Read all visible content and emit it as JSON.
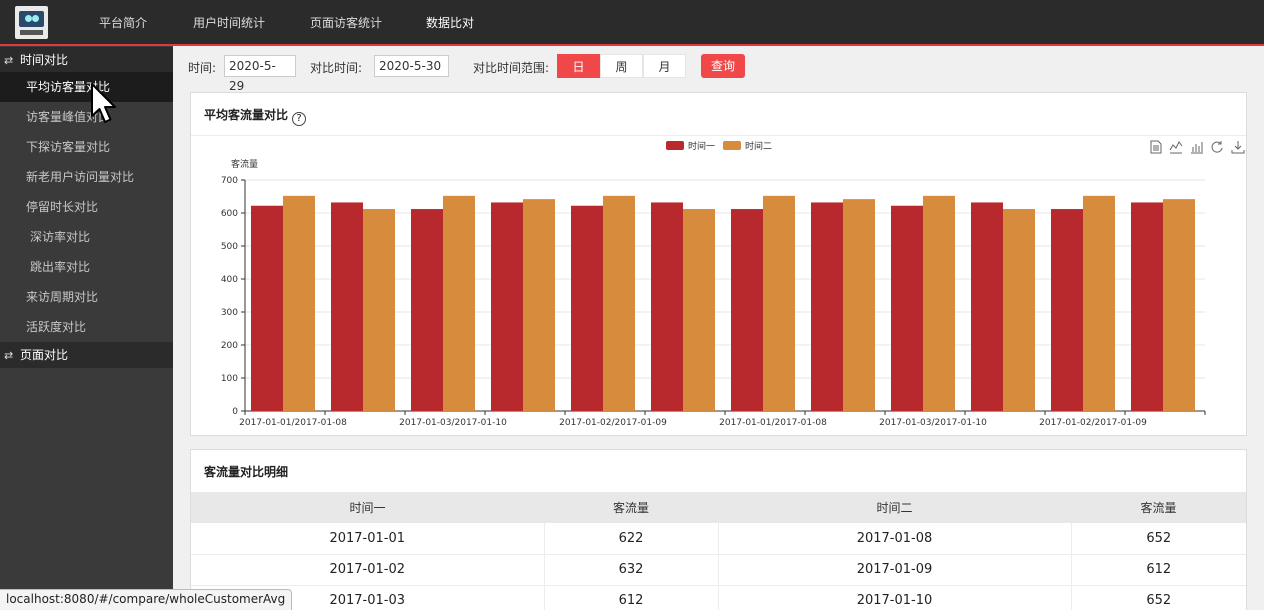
{
  "nav": {
    "items": [
      "平台简介",
      "用户时间统计",
      "页面访客统计",
      "数据比对"
    ],
    "active_index": 3
  },
  "sidebar": {
    "groups": [
      {
        "icon": "swap-icon",
        "label": "时间对比"
      },
      {
        "icon": "swap-icon",
        "label": "页面对比"
      }
    ],
    "items": [
      "平均访客量对比",
      "访客量峰值对比",
      "下探访客量对比",
      "新老用户访问量对比",
      "停留时长对比",
      "深访率对比",
      "跳出率对比",
      "来访周期对比",
      "活跃度对比"
    ],
    "active_index": 0
  },
  "filter": {
    "time_label": "时间:",
    "time_value": "2020-5-29",
    "compare_label": "对比时间:",
    "compare_value": "2020-5-30",
    "range_label": "对比时间范围:",
    "range_options": [
      "日",
      "周",
      "月"
    ],
    "range_selected": "日",
    "query_label": "查询"
  },
  "chart_panel": {
    "title": "平均客流量对比",
    "help_glyph": "?",
    "toolbox_icons": [
      "data-view-icon",
      "line-chart-icon",
      "bar-chart-icon",
      "restore-icon",
      "download-icon"
    ]
  },
  "chart_data": {
    "type": "bar",
    "ylabel": "客流量",
    "ylim": [
      0,
      700
    ],
    "yticks": [
      0,
      100,
      200,
      300,
      400,
      500,
      600,
      700
    ],
    "legend_position": "top-center",
    "colors": [
      "#b7292c",
      "#d68c3c"
    ],
    "categories": [
      "2017-01-01/2017-01-08",
      "2017-01-02/2017-01-09",
      "2017-01-03/2017-01-10",
      "2017-01-01/2017-01-08",
      "2017-01-02/2017-01-09",
      "2017-01-03/2017-01-10",
      "2017-01-01/2017-01-08",
      "2017-01-02/2017-01-09",
      "2017-01-03/2017-01-10",
      "2017-01-01/2017-01-08",
      "2017-01-02/2017-01-09",
      "2017-01-03/2017-01-10"
    ],
    "tick_labels_shown": [
      0,
      2,
      4,
      6,
      8,
      10
    ],
    "series": [
      {
        "name": "时间一",
        "values": [
          622,
          632,
          612,
          632,
          622,
          632,
          612,
          632,
          622,
          632,
          612,
          632
        ]
      },
      {
        "name": "时间二",
        "values": [
          652,
          612,
          652,
          642,
          652,
          612,
          652,
          642,
          652,
          612,
          652,
          642
        ]
      }
    ]
  },
  "table_panel": {
    "title": "客流量对比明细",
    "columns": [
      "时间一",
      "客流量",
      "时间二",
      "客流量"
    ],
    "rows": [
      [
        "2017-01-01",
        "622",
        "2017-01-08",
        "652"
      ],
      [
        "2017-01-02",
        "632",
        "2017-01-09",
        "612"
      ],
      [
        "2017-01-03",
        "612",
        "2017-01-10",
        "652"
      ]
    ]
  },
  "status_url": "localhost:8080/#/compare/wholeCustomerAvg"
}
